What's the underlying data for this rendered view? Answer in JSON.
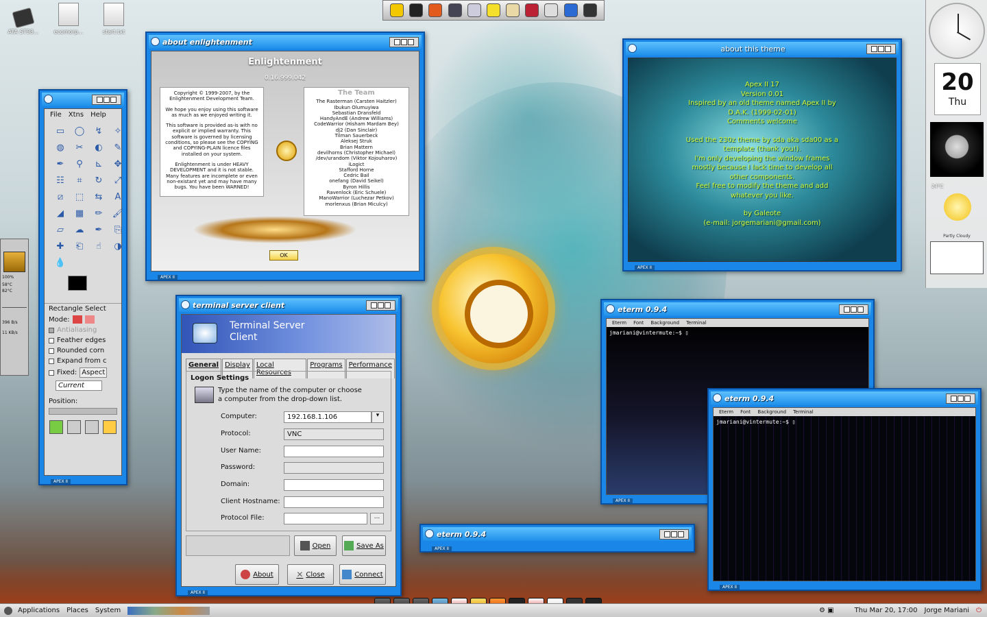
{
  "desktop_icons": [
    {
      "label": "ATA ST98..."
    },
    {
      "label": "ecomorp..."
    },
    {
      "label": "start.txt"
    }
  ],
  "about_e": {
    "title": "about enlightenment",
    "app_name": "Enlightenment",
    "version": "0.16.999.042",
    "left_text": [
      "Copyright © 1999-2007, by the Enlightenment Development Team.",
      "We hope you enjoy using this software as much as we enjoyed writing it.",
      "This software is provided as-is with no explicit or implied warranty. This software is governed by licensing conditions, so please see the COPYING and COPYING-PLAIN licence files installed on your system.",
      "Enlightenment is under HEAVY DEVELOPMENT and it is not stable. Many features are incomplete or even non-existant yet and may have many bugs. You have been WARNED!"
    ],
    "team_title": "The Team",
    "team": [
      "The Rasterman (Carsten Haitzler)",
      "Ibukun Olumuyiwa",
      "Sebastian Dransfeld",
      "HandyAndE (Andrew Williams)",
      "CodeWarrior (Hisham Mardam Bey)",
      "dj2 (Dan Sinclair)",
      "Tilman Sauerbeck",
      "Aleksej Struk",
      "Brian Mattern",
      "devilhorns (Christopher Michael)",
      "/dev/urandom (Viktor Kojouharov)",
      "iLogict",
      "Stafford Horne",
      "Cedric Bail",
      "onefang (David Seikel)",
      "Byron Hillis",
      "Ravenlock (Eric Schuele)",
      "ManoWarrior (Luchezar Petkov)",
      "morlenxus (Brian Miculcy)"
    ],
    "ok_label": "OK",
    "footer": "APEX II"
  },
  "about_theme": {
    "title": "about this theme",
    "text": [
      "Apex II 17",
      "Version 0.01",
      "Inspired by an old theme named Apex II by",
      "D.A.K. (1999-02-01)",
      "Comments welcome",
      "",
      "Used the 230z theme by sda aka sda00 as a",
      "template (thank you!).",
      "I'm only developing the window frames",
      "mostly because I lack time to develop all",
      "other components.",
      "Feel free to modify the theme and add",
      "whatever you like.",
      "",
      "by Galeote",
      "(e-mail: jorgemariani@gmail.com)"
    ],
    "footer": "APEX II"
  },
  "gimp": {
    "menu": [
      "File",
      "Xtns",
      "Help"
    ],
    "tool_icons": [
      "rect-select-icon",
      "ellipse-select-icon",
      "lasso-icon",
      "wand-icon",
      "color-select-icon",
      "scissors-icon",
      "foreground-select-icon",
      "paths-icon",
      "color-picker-icon",
      "zoom-icon",
      "measure-icon",
      "move-icon",
      "align-icon",
      "crop-icon",
      "rotate-icon",
      "scale-icon",
      "shear-icon",
      "perspective-icon",
      "flip-icon",
      "text-icon",
      "bucket-icon",
      "blend-icon",
      "pencil-icon",
      "brush-icon",
      "eraser-icon",
      "airbrush-icon",
      "ink-icon",
      "clone-icon",
      "heal-icon",
      "perspective-clone-icon",
      "smudge-icon",
      "dodge-icon",
      "blur-icon"
    ],
    "tool_name": "Rectangle Select",
    "mode_label": "Mode:",
    "options": [
      {
        "label": "Antialiasing",
        "checked": true,
        "disabled": true
      },
      {
        "label": "Feather edges",
        "checked": false
      },
      {
        "label": "Rounded corn",
        "checked": false
      },
      {
        "label": "Expand from c",
        "checked": false
      }
    ],
    "fixed_label": "Fixed:",
    "fixed_value": "Aspect",
    "current_value": "Current",
    "position_label": "Position:",
    "footer": "APEX II"
  },
  "tsc": {
    "title": "terminal server client",
    "header": [
      "Terminal Server",
      "Client"
    ],
    "tabs": [
      "General",
      "Display",
      "Local Resources",
      "Programs",
      "Performance"
    ],
    "section": "Logon Settings",
    "description": [
      "Type the name of the computer or choose",
      "a computer from the drop-down list."
    ],
    "fields": [
      {
        "label": "Computer:",
        "value": "192.168.1.106"
      },
      {
        "label": "Protocol:",
        "value": "VNC"
      },
      {
        "label": "User Name:",
        "value": ""
      },
      {
        "label": "Password:",
        "value": ""
      },
      {
        "label": "Domain:",
        "value": ""
      },
      {
        "label": "Client Hostname:",
        "value": ""
      },
      {
        "label": "Protocol File:",
        "value": ""
      }
    ],
    "browse_label": "...",
    "open_label": "Open",
    "saveas_label": "Save As",
    "about_label": "About",
    "close_label": "Close",
    "connect_label": "Connect",
    "footer": "APEX II"
  },
  "eterm1": {
    "title": "eterm 0.9.4",
    "menu": [
      "Eterm",
      "Font",
      "Background",
      "Terminal"
    ],
    "prompt": "jmariani@vintermute:~$",
    "footer": "APEX II"
  },
  "eterm2": {
    "title": "eterm 0.9.4",
    "menu": [
      "Eterm",
      "Font",
      "Background",
      "Terminal"
    ],
    "prompt": "jmariani@vintermute:~$",
    "footer": "APEX II"
  },
  "eterm3": {
    "title": "eterm 0.9.4",
    "footer": "APEX II"
  },
  "gkrellm": {
    "cpu": "100%",
    "temp1": "58°C",
    "temp2": "82°C",
    "net1": "396 B/s",
    "net2": "11 KB/s"
  },
  "right_panel": {
    "day": "20",
    "weekday": "Thu",
    "temperature": "24°C",
    "condition": "Partly Cloudy"
  },
  "panel": {
    "menus": [
      "Applications",
      "Places",
      "System"
    ],
    "datetime": "Thu Mar 20, 17:00",
    "user": "Jorge Mariani"
  }
}
